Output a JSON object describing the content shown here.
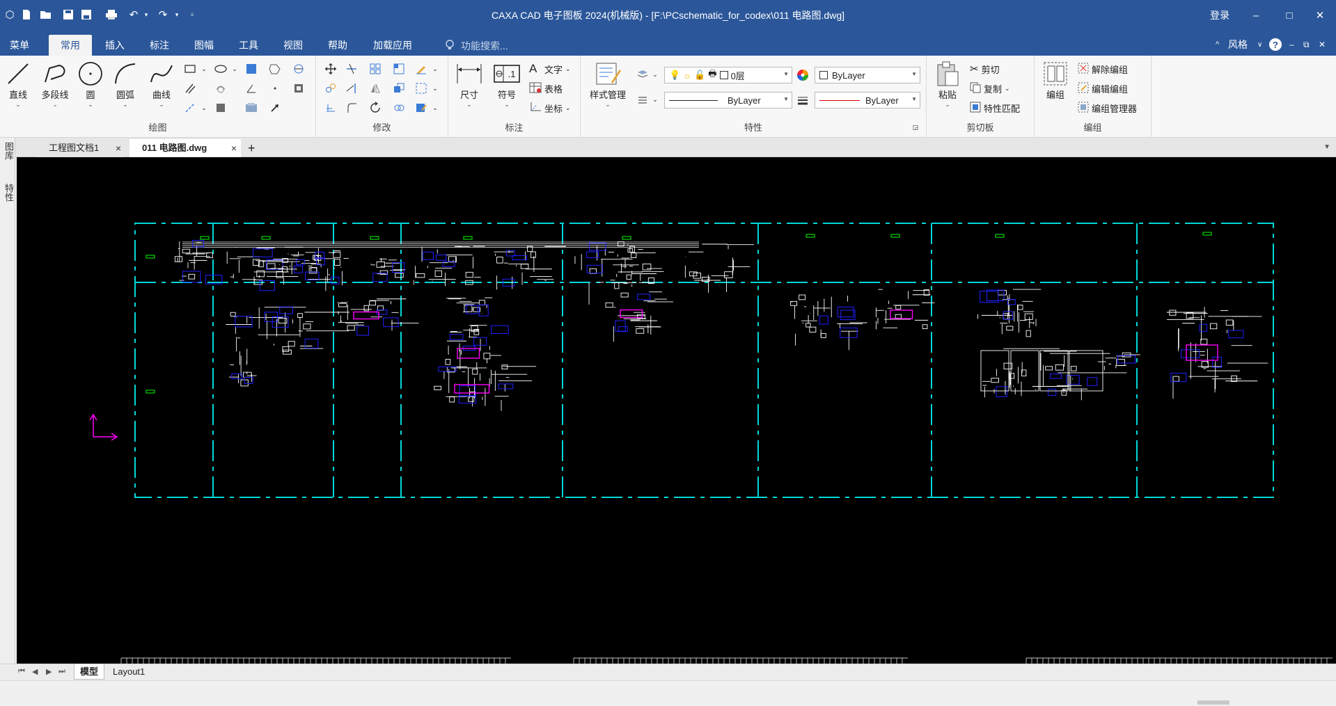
{
  "titlebar": {
    "title": "CAXA CAD 电子图板 2024(机械版) - [F:\\PCschematic_for_codex\\011 电路图.dwg]",
    "login": "登录"
  },
  "tabs": {
    "items": [
      "菜单",
      "常用",
      "插入",
      "标注",
      "图幅",
      "工具",
      "视图",
      "帮助",
      "加载应用"
    ],
    "search_placeholder": "功能搜索...",
    "style_label": "风格"
  },
  "ribbon": {
    "draw": {
      "label": "绘图",
      "line": "直线",
      "polyline": "多段线",
      "circle": "圆",
      "arc": "圆弧",
      "curve": "曲线"
    },
    "modify": {
      "label": "修改"
    },
    "annotate": {
      "label": "标注",
      "dimension": "尺寸",
      "symbol": "符号",
      "text": "文字",
      "table": "表格",
      "coordinate": "坐标"
    },
    "properties": {
      "label": "特性",
      "style_manager": "样式管理",
      "layer": "0层",
      "color": "ByLayer",
      "linetype": "ByLayer",
      "lineweight": "ByLayer"
    },
    "clipboard": {
      "label": "剪切板",
      "paste": "粘贴",
      "cut": "剪切",
      "copy": "复制",
      "match": "特性匹配"
    },
    "group": {
      "label": "编组",
      "group_btn": "编组",
      "ungroup": "解除编组",
      "edit_group": "编辑编组",
      "group_manager": "编组管理器"
    }
  },
  "doctabs": {
    "tab1": "工程图文档1",
    "tab2": "011 电路图.dwg"
  },
  "leftstrip": {
    "items": [
      "图库",
      "特性"
    ]
  },
  "bottom": {
    "model_tab": "模型",
    "layout_tab": "Layout1"
  },
  "colors": {
    "accent": "#2b579a",
    "frame": "#00d8d8",
    "component": "#ffffff",
    "highlight": "#ff00ff",
    "blue": "#2020ff",
    "green": "#00ff00"
  }
}
